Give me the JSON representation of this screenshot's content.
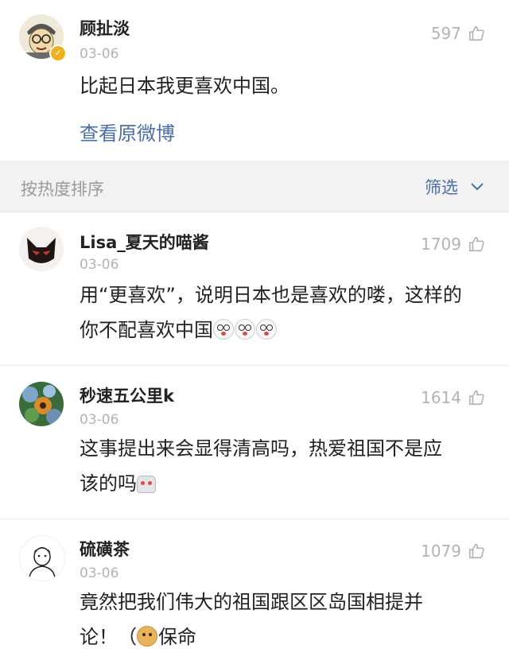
{
  "post": {
    "author": "顾扯淡",
    "time": "03-06",
    "likes": "597",
    "text": "比起日本我更喜欢中国。",
    "view_original": "查看原微博"
  },
  "sort_bar": {
    "label": "按热度排序",
    "filter_label": "筛选"
  },
  "comments": [
    {
      "author": "Lisa_夏天的喵酱",
      "time": "03-06",
      "likes": "1709",
      "text_line1": "用“更喜欢”，说明日本也是喜欢的喽，这样的",
      "text_line2": "你不配喜欢中国"
    },
    {
      "author": "秒速五公里k",
      "time": "03-06",
      "likes": "1614",
      "text_line1": "这事提出来会显得清高吗，热爱祖国不是应",
      "text_line2": "该的吗"
    },
    {
      "author": "硫磺茶",
      "time": "03-06",
      "likes": "1079",
      "text_line1": "竟然把我们伟大的祖国跟区区岛国相提并",
      "text_line2": "论！（",
      "text_line2_after": "保命"
    }
  ],
  "icons": {
    "like": "thumb-up-icon",
    "filter_arrow": "chevron-down-icon",
    "verified": "verified-badge-icon",
    "emoji_dizzy": "dizzy-face-emoji",
    "emoji_robot": "robot-emoji",
    "emoji_doge": "doge-emoji"
  },
  "colors": {
    "link": "#4a6fa5",
    "muted": "#b3b3b3",
    "text": "#222222",
    "sort_bar_bg": "#f2f2f2",
    "verified": "#f2b01e"
  }
}
